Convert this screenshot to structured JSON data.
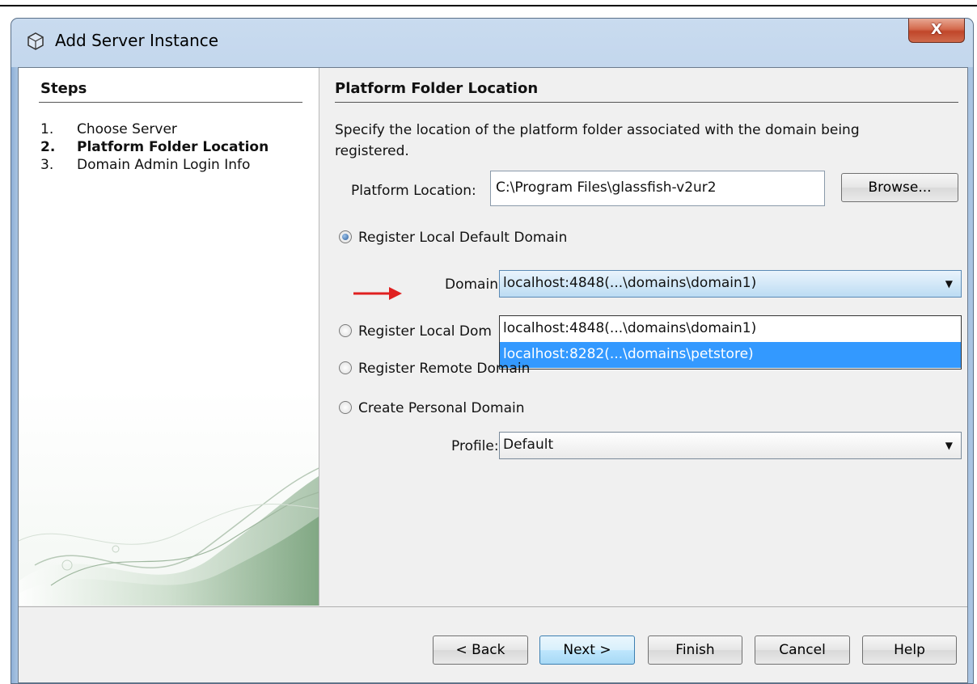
{
  "window": {
    "title": "Add Server Instance",
    "close_label": "X"
  },
  "steps": {
    "header": "Steps",
    "items": [
      {
        "num": "1.",
        "label": "Choose Server"
      },
      {
        "num": "2.",
        "label": "Platform Folder Location"
      },
      {
        "num": "3.",
        "label": "Domain Admin Login Info"
      }
    ]
  },
  "main": {
    "title": "Platform Folder Location",
    "description": "Specify the location of the platform folder associated with the domain being registered.",
    "platform_label": "Platform Location:",
    "platform_value": "C:\\Program Files\\glassfish-v2ur2",
    "browse_label": "Browse...",
    "options": [
      {
        "label": "Register Local Default Domain",
        "selected": true
      },
      {
        "label": "Register Local Dom",
        "selected": false
      },
      {
        "label": "Register Remote Domain",
        "selected": false
      },
      {
        "label": "Create Personal Domain",
        "selected": false
      }
    ],
    "domain_label": "Domain:",
    "domain_value": "localhost:4848(...\\domains\\domain1)",
    "domain_options": [
      "localhost:4848(...\\domains\\domain1)",
      "localhost:8282(...\\domains\\petstore)"
    ],
    "profile_label": "Profile:",
    "profile_value": "Default"
  },
  "footer": {
    "back": "< Back",
    "next": "Next >",
    "finish": "Finish",
    "cancel": "Cancel",
    "help": "Help"
  },
  "colors": {
    "highlight": "#3399ff",
    "annotation_arrow": "#e02020"
  }
}
